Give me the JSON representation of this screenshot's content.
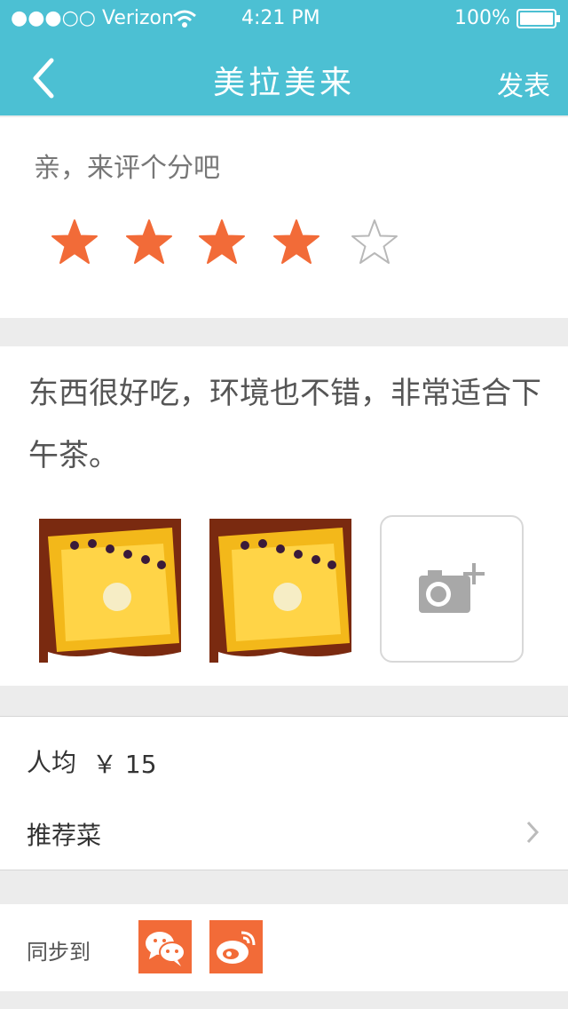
{
  "status_bar": {
    "carrier": "●●●○○ Verizon",
    "time": "4:21 PM",
    "battery": "100%"
  },
  "header": {
    "title": "美拉美来",
    "publish_label": "发表"
  },
  "rating": {
    "prompt": "亲，来评个分吧",
    "value": 4,
    "max": 5,
    "accent_color": "#f26b38"
  },
  "review": {
    "text": "东西很好吃，环境也不错，非常适合下午茶。",
    "photos": [
      {
        "icon": "cake-photo"
      },
      {
        "icon": "cake-photo"
      }
    ],
    "add_photo_icon": "camera-plus-icon"
  },
  "details": {
    "avg_label": "人均",
    "avg_price": "￥ 15",
    "dishes_label": "推荐菜"
  },
  "share": {
    "label": "同步到",
    "targets": [
      {
        "icon": "wechat-icon"
      },
      {
        "icon": "weibo-icon"
      }
    ]
  }
}
